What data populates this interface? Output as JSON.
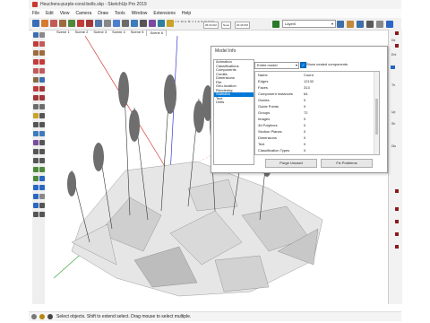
{
  "window": {
    "title": "Heuchera-purple-coral-bells.skp - SketchUp Pro 2019"
  },
  "menu": [
    "File",
    "Edit",
    "View",
    "Camera",
    "Draw",
    "Tools",
    "Window",
    "Extensions",
    "Help"
  ],
  "shadows": {
    "months": "J F M A M J J A S O N D",
    "time_start": "06:33 AM",
    "noon": "Noon",
    "time_end": "04:46 PM"
  },
  "layer": {
    "selected": "Layer0"
  },
  "scenes": [
    "Scene 1",
    "Scene 2",
    "Scene 3",
    "Scene 4",
    "Scene 5",
    "Scene 6"
  ],
  "model_info": {
    "title": "Model Info",
    "categories": [
      "Animation",
      "Classifications",
      "Components",
      "Credits",
      "Dimensions",
      "File",
      "Geo-location",
      "Rendering",
      "Statistics",
      "Text",
      "Units"
    ],
    "selected_category": "Statistics",
    "scope": "Entire model",
    "show_nested_label": "Show nested components",
    "table_header": {
      "name": "Name",
      "count": "Count"
    },
    "rows": [
      {
        "name": "Edges",
        "count": "12132"
      },
      {
        "name": "Faces",
        "count": "313"
      },
      {
        "name": "Component Instances",
        "count": "64"
      },
      {
        "name": "Guides",
        "count": "0"
      },
      {
        "name": "Guide Points",
        "count": "0"
      },
      {
        "name": "Groups",
        "count": "72"
      },
      {
        "name": "Images",
        "count": "0"
      },
      {
        "name": "3d Polylines",
        "count": "0"
      },
      {
        "name": "Section Planes",
        "count": "0"
      },
      {
        "name": "Dimensions",
        "count": "0"
      },
      {
        "name": "Text",
        "count": "0"
      },
      {
        "name": "Classification Types",
        "count": "0"
      }
    ],
    "purge_label": "Purge Unused",
    "fix_label": "Fix Problems"
  },
  "tray": {
    "labels": [
      "De",
      "Ent",
      "Tir",
      "Up",
      "Sh",
      "Dis"
    ]
  },
  "status": {
    "hint": "Select objects. Shift to extend select. Drag mouse to select multiple."
  },
  "colors": {
    "selection": "#0078d7",
    "axis_red": "#d23a3a",
    "axis_green": "#3aa63a",
    "axis_blue": "#3a3ad2",
    "plant": "#bdbdbd"
  }
}
